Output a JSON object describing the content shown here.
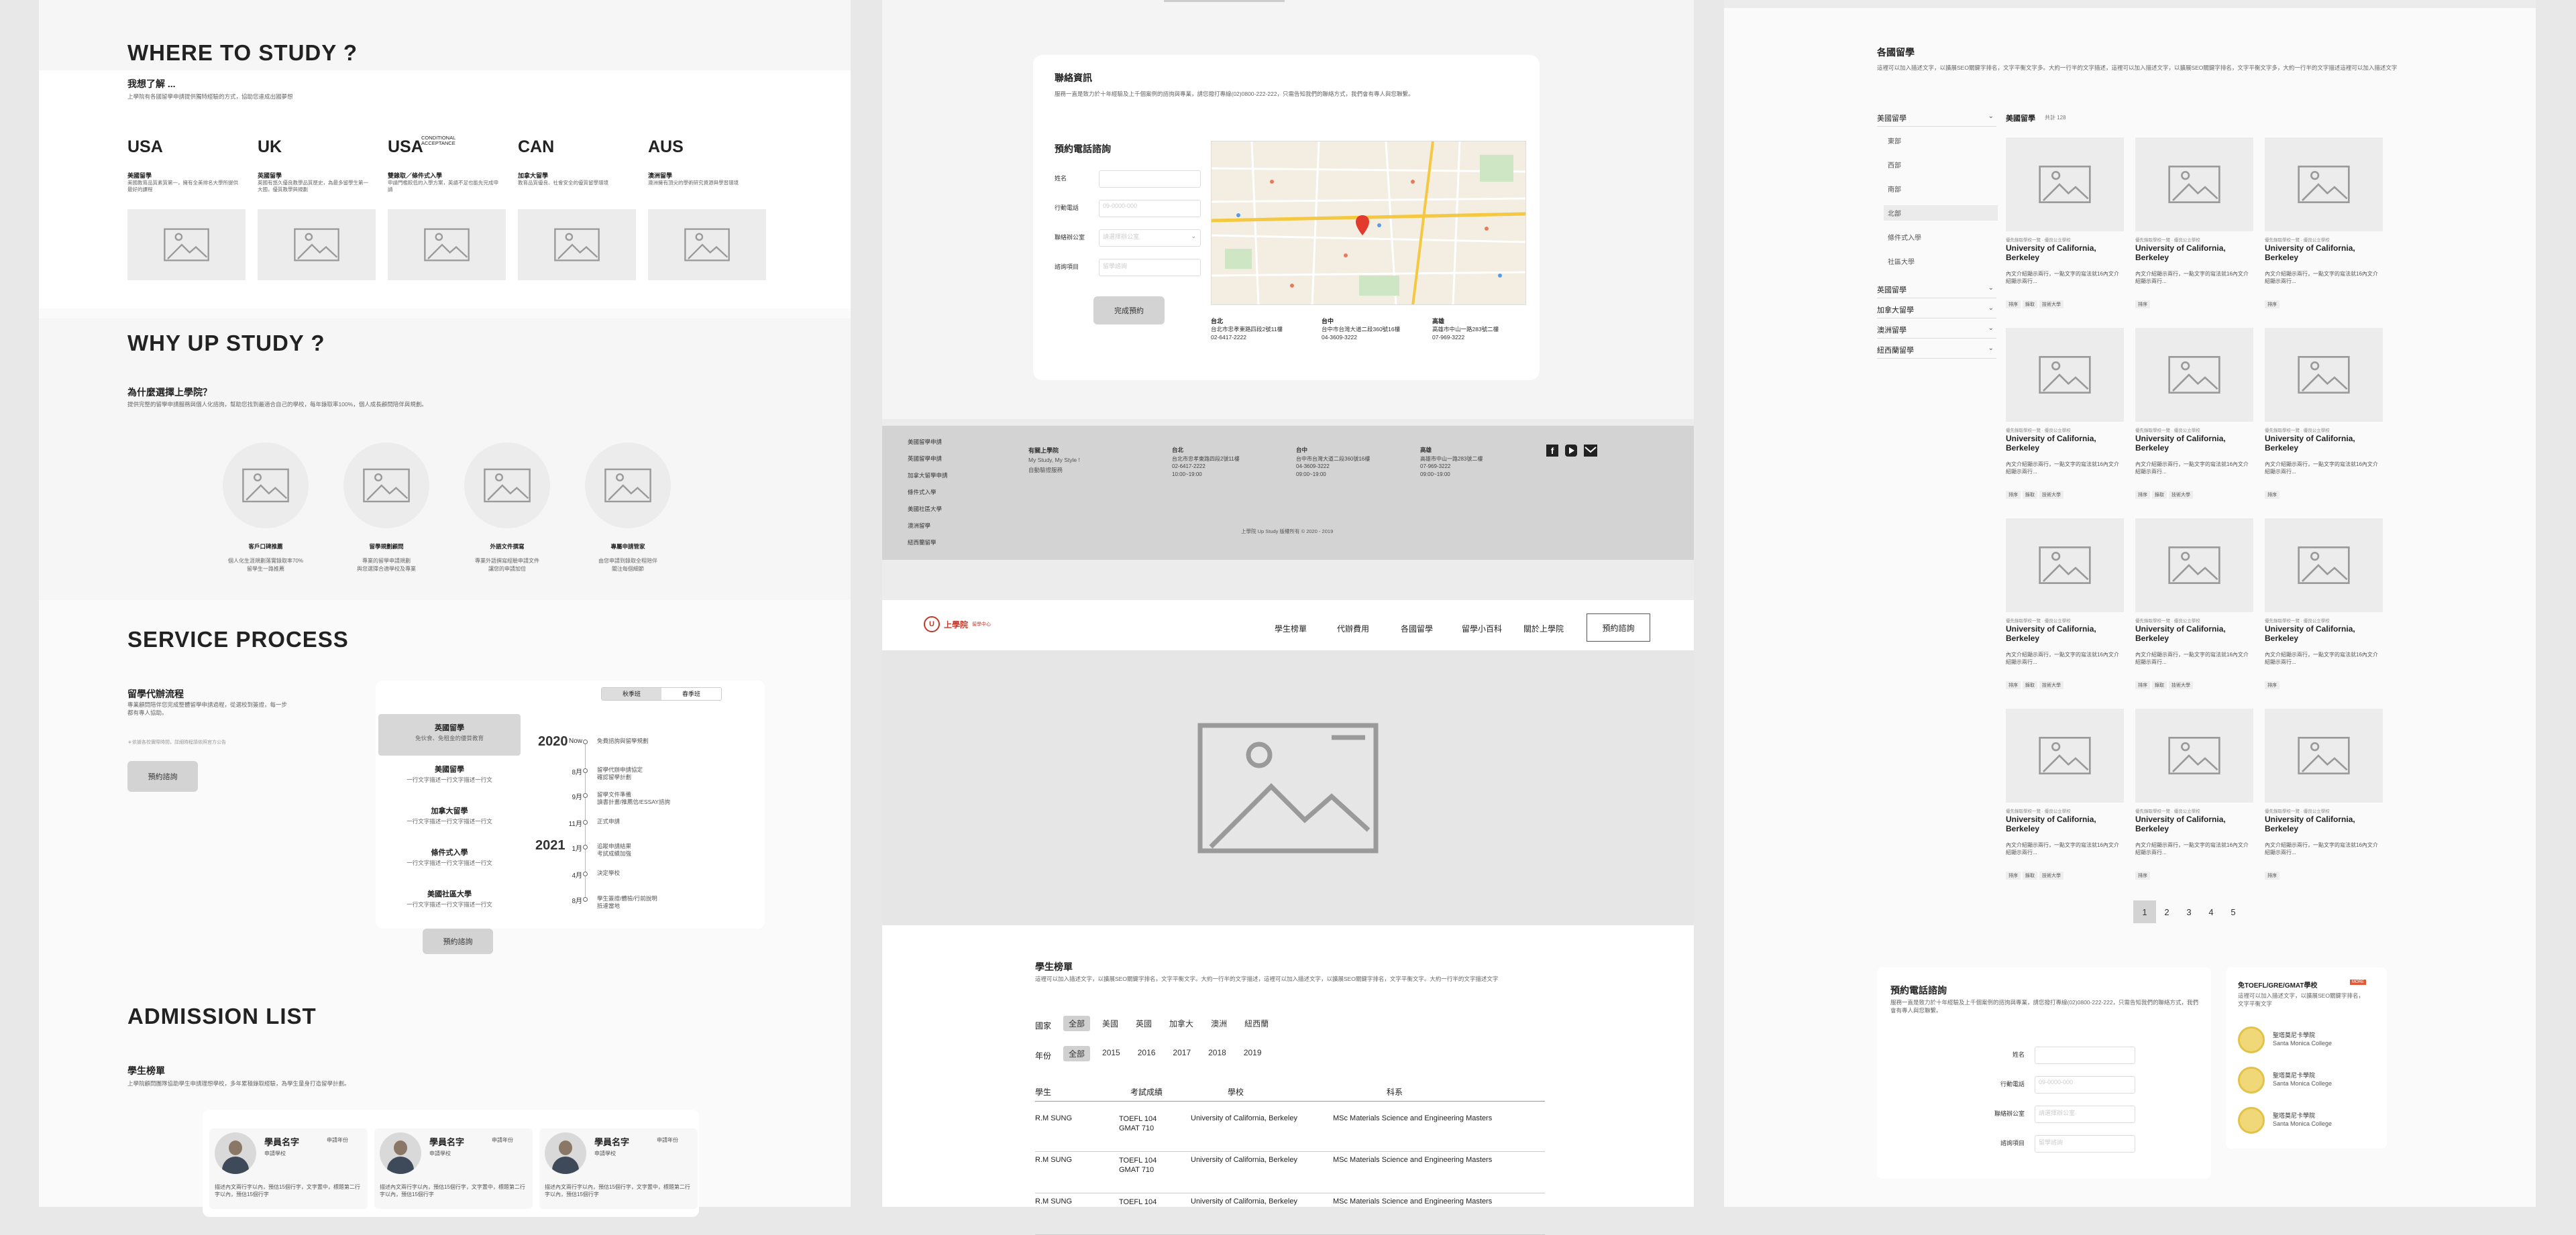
{
  "col1": {
    "study": {
      "title": "WHERE TO STUDY ?",
      "subtitle": "我想了解 ...",
      "desc": "上學院有各國留學申請提供獨特經驗的方式，協助您達成出國夢想",
      "countries": [
        {
          "code": "USA",
          "extra": "",
          "name": "美國留學",
          "desc": "美國教育品質素質第一，擁有全美排名大學所提供最好的課程"
        },
        {
          "code": "UK",
          "extra": "",
          "name": "英國留學",
          "desc": "英國有悠久優良教學品質歷史，為最多留學生第一大國，優質教學與規劃"
        },
        {
          "code": "USA",
          "extra": "CONDITIONAL ACCEPTANCE",
          "name": "雙錄取／條件式入學",
          "desc": "申請門檻較低的入學方案，英語不足也能先完成申請"
        },
        {
          "code": "CAN",
          "extra": "",
          "name": "加拿大留學",
          "desc": "教育品質優良、社會安全的優質留學環境"
        },
        {
          "code": "AUS",
          "extra": "",
          "name": "澳洲留學",
          "desc": "澳洲擁有頂尖的學術研究資源與學習環境"
        }
      ]
    },
    "why": {
      "title": "WHY UP STUDY ?",
      "subtitle": "為什麼選擇上學院？",
      "desc": "提供完整的留學申請服務與個人化諮詢，幫助您找到最適合自己的學校，每年錄取率100%，個人成長顧問陪伴與規劃。",
      "items": [
        {
          "name": "客戶口碑推薦",
          "desc": "個人化生涯規劃落實錄取率70%\n留學生一路推薦"
        },
        {
          "name": "留學規劃顧問",
          "desc": "專業的留學申請規劃\n與您選擇合適學校及專業"
        },
        {
          "name": "外語文件撰寫",
          "desc": "專業外語撰寫經驗申請文件\n讓您的申請加倍"
        },
        {
          "name": "專屬申請管家",
          "desc": "由您申請到錄取全程陪伴\n關注每個細節"
        }
      ]
    },
    "process": {
      "title": "SERVICE PROCESS",
      "subtitle": "留學代辦流程",
      "desc": "專業顧問陪伴您完成整體留學申請過程，從選校到簽證，每一步都有專人協助。",
      "note": "＊依據各校實際時間，詳細時程請依照官方公告",
      "button": "預約諮詢",
      "tabs": [
        "秋季班",
        "春季班"
      ],
      "steps": [
        {
          "name": "英國留學",
          "desc": "免伙食、免租金的優質教育"
        },
        {
          "name": "美國留學",
          "desc": "一行文字描述一行文字描述一行文"
        },
        {
          "name": "加拿大留學",
          "desc": "一行文字描述一行文字描述一行文"
        },
        {
          "name": "條件式入學",
          "desc": "一行文字描述一行文字描述一行文"
        },
        {
          "name": "美國社區大學",
          "desc": "一行文字描述一行文字描述一行文"
        }
      ],
      "year1": "2020",
      "year2": "2021",
      "timeline": [
        {
          "month": "Now",
          "text": "免費諮詢與留學規劃"
        },
        {
          "month": "8月",
          "text": "留學代辦申請協定\n確認留學計劃"
        },
        {
          "month": "9月",
          "text": "留學文件準備\n讀書計畫/推薦信/ESSAY諮詢"
        },
        {
          "month": "11月",
          "text": "正式申請"
        },
        {
          "month": "1月",
          "text": "追蹤申請結果\n考試成績加強"
        },
        {
          "month": "4月",
          "text": "決定學校"
        },
        {
          "month": "8月",
          "text": "學生簽證/體檢/行前說明\n抵達當地"
        }
      ],
      "button2": "預約諮詢"
    },
    "admission": {
      "title": "ADMISSION LIST",
      "subtitle": "學生榜單",
      "desc": "上學院顧問團隊協助學生申請理想學校，多年累積錄取經驗，為學生量身打造留學計劃。",
      "cards": [
        {
          "name": "學員名字",
          "tag": "申請年份",
          "school": "申請學校",
          "text": "描述內文兩行字以內，預估15個行字，文字置中，標題第二行字以內，預估15個行字"
        },
        {
          "name": "學員名字",
          "tag": "申請年份",
          "school": "申請學校",
          "text": "描述內文兩行字以內，預估15個行字，文字置中，標題第二行字以內，預估15個行字"
        },
        {
          "name": "學員名字",
          "tag": "申請年份",
          "school": "申請學校",
          "text": "描述內文兩行字以內，預估15個行字，文字置中，標題第二行字以內，預估15個行字"
        }
      ]
    }
  },
  "col2": {
    "contact": {
      "title": "聯絡資訊",
      "desc": "服務一直是致力於十年經驗及上千個案例的諮詢與專業，請您撥打專線(02)0800-222-222，只需告知我們的聯絡方式，我們會有專人與您聯繫。",
      "form_title": "預約電話諮詢",
      "fields": [
        {
          "label": "姓名",
          "placeholder": ""
        },
        {
          "label": "行動電話",
          "placeholder": "09-0000-000"
        },
        {
          "label": "聯絡辦公室",
          "placeholder": "請選擇辦公室"
        },
        {
          "label": "諮詢項目",
          "placeholder": "留學諮詢"
        }
      ],
      "submit": "完成預約",
      "offices": [
        {
          "city": "台北",
          "addr": "台北市忠孝東路四段2號11樓",
          "phone": "02-6417-2222"
        },
        {
          "city": "台中",
          "addr": "台中市台灣大道二段360號16樓",
          "phone": "04-3609-3222"
        },
        {
          "city": "高雄",
          "addr": "高雄市中山一路283號二樓",
          "phone": "07-969-3222"
        }
      ]
    },
    "footer": {
      "links": [
        "美國留學申請",
        "英國留學申請",
        "加拿大留學申請",
        "條件式入學",
        "美國社區大學",
        "澳洲留學",
        "紐西蘭留學"
      ],
      "brand_label": "有關上學院",
      "brand_lines": [
        "My Study, My Style !",
        "自動驗證服務"
      ],
      "offices": [
        {
          "city": "台北",
          "lines": [
            "台北市忠孝東路四段2號11樓",
            "02-6417-2222",
            "10:00~19:00"
          ]
        },
        {
          "city": "台中",
          "lines": [
            "台中市台灣大道二段360號16樓",
            "04-3609-3222",
            "09:00~19:00"
          ]
        },
        {
          "city": "高雄",
          "lines": [
            "高雄市中山一路283號二樓",
            "07-969-3222",
            "09:00~19:00"
          ]
        }
      ],
      "copyright": "上學院 Up Study 版權所有 © 2020 - 2019"
    },
    "nav": {
      "brand": "上學院",
      "brand_sub": "留學中心",
      "items": [
        "學生榜單",
        "代辦費用",
        "各國留學",
        "留學小百科",
        "關於上學院"
      ],
      "cta": "預約諮詢"
    },
    "list": {
      "title": "學生榜單",
      "desc": "這裡可以加入描述文字，以擴展SEO關鍵字排名，文字平衡文字。大約一行半的文字描述，這裡可以加入描述文字，以擴展SEO關鍵字排名，文字平衡文字。大約一行半的文字描述文字",
      "country_label": "國家",
      "countries": [
        "全部",
        "美國",
        "英國",
        "加拿大",
        "澳洲",
        "紐西蘭"
      ],
      "year_label": "年份",
      "years": [
        "全部",
        "2015",
        "2016",
        "2017",
        "2018",
        "2019"
      ],
      "headers": [
        "學生",
        "考試成績",
        "學校",
        "科系"
      ],
      "rows": [
        {
          "student": "R.M SUNG",
          "score": "TOEFL 104\nGMAT 710",
          "school": "University of California, Berkeley",
          "major": "MSc Materials Science and Engineering Masters"
        },
        {
          "student": "R.M SUNG",
          "score": "TOEFL 104\nGMAT 710",
          "school": "University of California, Berkeley",
          "major": "MSc Materials Science and Engineering Masters"
        },
        {
          "student": "R.M SUNG",
          "score": "TOEFL 104",
          "school": "University of California, Berkeley",
          "major": "MSc Materials Science and Engineering Masters"
        }
      ]
    }
  },
  "col3": {
    "title": "各國留學",
    "desc": "這裡可以加入描述文字，以擴展SEO關鍵字排名，文字平衡文字多。大約一行半的文字描述，這裡可以加入描述文字，以擴展SEO關鍵字排名，文字平衡文字多，大約一行半的文字描述這裡可以加入描述文字",
    "categories": [
      {
        "name": "美國留學",
        "subs": [
          "東部",
          "西部",
          "南部",
          "北部",
          "條件式入學",
          "社區大學"
        ]
      },
      {
        "name": "英國留學",
        "subs": []
      },
      {
        "name": "加拿大留學",
        "subs": []
      },
      {
        "name": "澳洲留學",
        "subs": []
      },
      {
        "name": "紐西蘭留學",
        "subs": []
      }
    ],
    "result_title": "美國留學",
    "result_count": "共計 128",
    "card": {
      "label": "優先錄取學校一覽 · 優良公立學校",
      "name": "University of California, Berkeley",
      "desc": "內文介紹顯示兩行，一點文字的寫法就16內文介紹顯示兩行...",
      "tags": [
        "排序",
        "錄取",
        "技術大學"
      ]
    },
    "pages": [
      "1",
      "2",
      "3",
      "4",
      "5"
    ],
    "booking": {
      "title": "預約電話諮詢",
      "desc": "服務一直是致力於十年經驗及上千個案例的諮詢與專業，請您撥打專線(02)0800-222-222，只需告知我們的聯絡方式，我們會有專人與您聯繫。",
      "fields": [
        {
          "label": "姓名",
          "placeholder": ""
        },
        {
          "label": "行動電話",
          "placeholder": "09-0000-000"
        },
        {
          "label": "聯絡辦公室",
          "placeholder": "請選擇辦公室"
        },
        {
          "label": "諮詢項目",
          "placeholder": "留學諮詢"
        }
      ]
    },
    "side": {
      "title": "免TOEFL/GRE/GMAT學校",
      "badge": "MORE",
      "desc": "這裡可以加入描述文字，以擴展SEO關鍵字排名，文字平衡文字",
      "schools": [
        {
          "name": "聖塔莫尼卡學院",
          "en": "Santa Monica College"
        },
        {
          "name": "聖塔莫尼卡學院",
          "en": "Santa Monica College"
        },
        {
          "name": "聖塔莫尼卡學院",
          "en": "Santa Monica College"
        }
      ]
    }
  }
}
